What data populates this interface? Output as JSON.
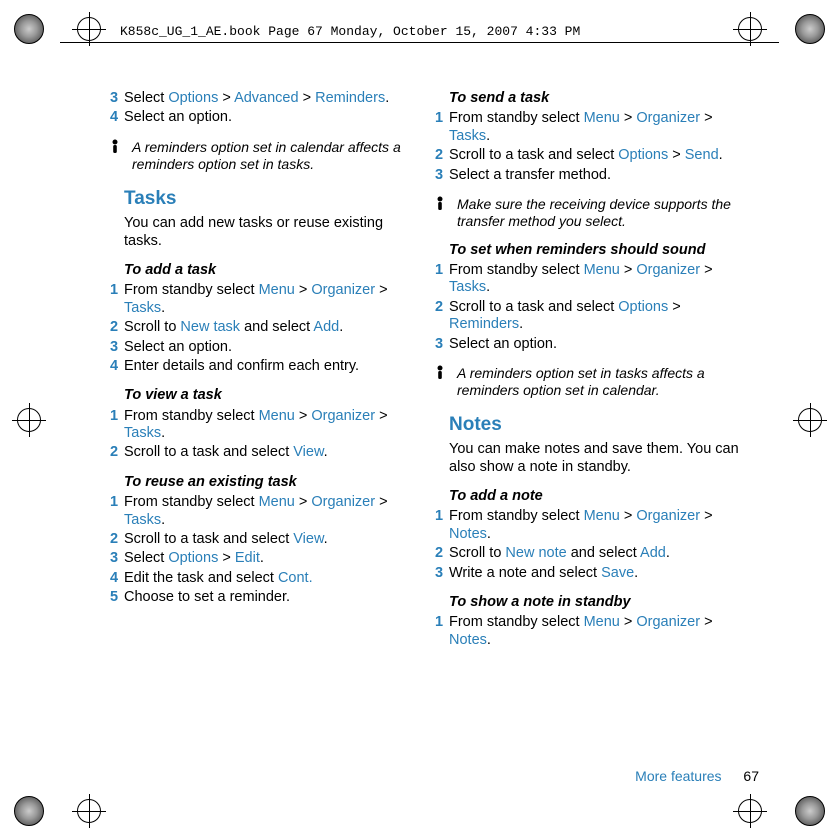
{
  "header": "K858c_UG_1_AE.book  Page 67  Monday, October 15, 2007  4:33 PM",
  "left": {
    "step3": {
      "n": "3",
      "pre": "Select ",
      "a": "Options",
      "sep1": " > ",
      "b": "Advanced",
      "sep2": " > ",
      "c": "Reminders",
      "post": "."
    },
    "step4": {
      "n": "4",
      "text": "Select an option."
    },
    "note1": "A reminders option set in calendar affects a reminders option set in tasks.",
    "tasks_title": "Tasks",
    "tasks_body": "You can add new tasks or reuse existing tasks.",
    "add_task_h": "To add a task",
    "add_task": {
      "s1": {
        "n": "1",
        "pre": "From standby select ",
        "a": "Menu",
        "sep1": " > ",
        "b": "Organizer",
        "sep2": " > ",
        "c": "Tasks",
        "post": "."
      },
      "s2": {
        "n": "2",
        "pre": "Scroll to ",
        "a": "New task",
        "mid": " and select ",
        "b": "Add",
        "post": "."
      },
      "s3": {
        "n": "3",
        "text": "Select an option."
      },
      "s4": {
        "n": "4",
        "text": "Enter details and confirm each entry."
      }
    },
    "view_task_h": "To view a task",
    "view_task": {
      "s1": {
        "n": "1",
        "pre": "From standby select ",
        "a": "Menu",
        "sep1": " > ",
        "b": "Organizer",
        "sep2": " > ",
        "c": "Tasks",
        "post": "."
      },
      "s2": {
        "n": "2",
        "pre": "Scroll to a task and select ",
        "a": "View",
        "post": "."
      }
    },
    "reuse_task_h": "To reuse an existing task",
    "reuse_task": {
      "s1": {
        "n": "1",
        "pre": "From standby select ",
        "a": "Menu",
        "sep1": " > ",
        "b": "Organizer",
        "sep2": " > ",
        "c": "Tasks",
        "post": "."
      },
      "s2": {
        "n": "2",
        "pre": "Scroll to a task and select ",
        "a": "View",
        "post": "."
      },
      "s3": {
        "n": "3",
        "pre": "Select ",
        "a": "Options",
        "sep1": " > ",
        "b": "Edit",
        "post": "."
      },
      "s4": {
        "n": "4",
        "pre": "Edit the task and select ",
        "a": "Cont.",
        "post": ""
      },
      "s5": {
        "n": "5",
        "text": "Choose to set a reminder."
      }
    }
  },
  "right": {
    "send_task_h": "To send a task",
    "send_task": {
      "s1": {
        "n": "1",
        "pre": "From standby select ",
        "a": "Menu",
        "sep1": " > ",
        "b": "Organizer",
        "sep2": " > ",
        "c": "Tasks",
        "post": "."
      },
      "s2": {
        "n": "2",
        "pre": "Scroll to a task and select ",
        "a": "Options",
        "sep2": " > ",
        "b": "Send",
        "post": "."
      },
      "s3": {
        "n": "3",
        "text": "Select a transfer method."
      }
    },
    "note1": "Make sure the receiving device supports the transfer method you select.",
    "reminders_h": "To set when reminders should sound",
    "reminders": {
      "s1": {
        "n": "1",
        "pre": "From standby select ",
        "a": "Menu",
        "sep1": " > ",
        "b": "Organizer",
        "sep2": " > ",
        "c": "Tasks",
        "post": "."
      },
      "s2": {
        "n": "2",
        "pre": "Scroll to a task and select ",
        "a": "Options",
        "sep2": " > ",
        "b": "Reminders",
        "post": "."
      },
      "s3": {
        "n": "3",
        "text": "Select an option."
      }
    },
    "note2": "A reminders option set in tasks affects a reminders option set in calendar.",
    "notes_title": "Notes",
    "notes_body": "You can make notes and save them. You can also show a note in standby.",
    "add_note_h": "To add a note",
    "add_note": {
      "s1": {
        "n": "1",
        "pre": "From standby select ",
        "a": "Menu",
        "sep1": " > ",
        "b": "Organizer",
        "sep2": " > ",
        "c": "Notes",
        "post": "."
      },
      "s2": {
        "n": "2",
        "pre": "Scroll to ",
        "a": "New note",
        "mid": " and select ",
        "b": "Add",
        "post": "."
      },
      "s3": {
        "n": "3",
        "pre": "Write a note and select ",
        "a": "Save",
        "post": "."
      }
    },
    "show_note_h": "To show a note in standby",
    "show_note": {
      "s1": {
        "n": "1",
        "pre": "From standby select ",
        "a": "Menu",
        "sep1": " > ",
        "b": "Organizer",
        "sep2": " > ",
        "c": "Notes",
        "post": "."
      }
    }
  },
  "footer": {
    "label": "More features",
    "num": "67"
  }
}
